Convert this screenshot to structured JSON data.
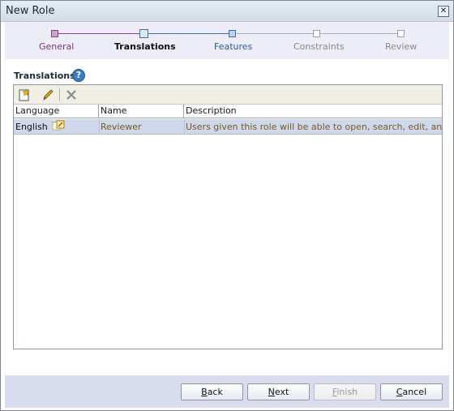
{
  "window": {
    "title": "New Role",
    "close_glyph": "✕"
  },
  "train": {
    "steps": [
      {
        "label": "General",
        "state": "done"
      },
      {
        "label": "Translations",
        "state": "current"
      },
      {
        "label": "Features",
        "state": "next"
      },
      {
        "label": "Constraints",
        "state": "future"
      },
      {
        "label": "Review",
        "state": "future"
      }
    ],
    "colors": {
      "done": "#8b3d8e",
      "current": "#3c6fb5",
      "future": "#9aa0a6"
    }
  },
  "section": {
    "title": "Translations",
    "help_glyph": "?"
  },
  "toolbar": {
    "buttons": [
      {
        "name": "new-icon"
      },
      {
        "name": "edit-pencil-icon"
      },
      {
        "name": "delete-x-icon"
      }
    ]
  },
  "table": {
    "columns": [
      "Language",
      "Name",
      "Description"
    ],
    "rows": [
      {
        "language": "English",
        "language_icon": "translation-edit-icon",
        "name": "Reviewer",
        "description": "Users given this role will be able to open, search, edit, and print a"
      }
    ]
  },
  "footer": {
    "back": {
      "pre": "",
      "mnemonic": "B",
      "post": "ack"
    },
    "next": {
      "pre": "",
      "mnemonic": "N",
      "post": "ext"
    },
    "finish": {
      "pre": "",
      "mnemonic": "F",
      "post": "inish"
    },
    "cancel": {
      "pre": "",
      "mnemonic": "C",
      "post": "ancel"
    }
  }
}
